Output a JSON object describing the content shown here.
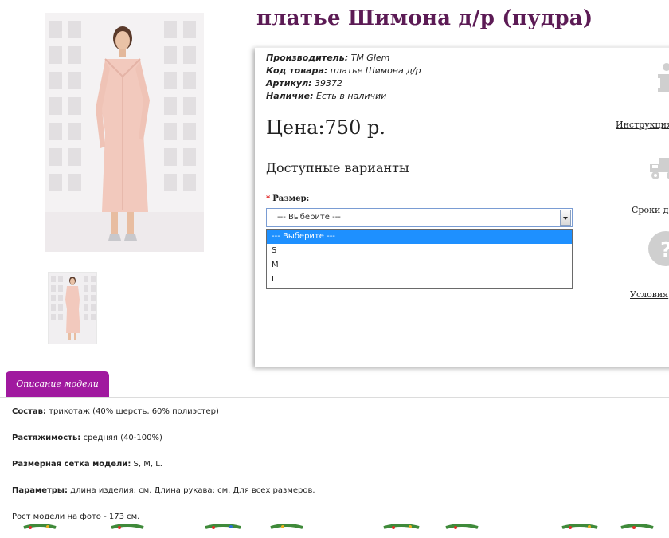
{
  "product": {
    "title": "платье Шимона д/р (пудра)"
  },
  "info": {
    "manufacturer_label": "Производитель:",
    "manufacturer_value": "TM Glem",
    "code_label": "Код товара:",
    "code_value": "платье Шимона д/р",
    "article_label": "Артикул:",
    "article_value": "39372",
    "stock_label": "Наличие:",
    "stock_value": "Есть в наличии"
  },
  "price": "Цена:750 р.",
  "variants_heading": "Доступные варианты",
  "size": {
    "required_mark": "*",
    "label": "Размер:",
    "selected": "--- Выберите ---",
    "options": [
      "--- Выберите ---",
      "S",
      "M",
      "L"
    ]
  },
  "side_links": {
    "instructions": "Инструкция",
    "delivery": "Сроки до",
    "conditions": "Условия"
  },
  "tab": {
    "label": "Описание модели"
  },
  "description": {
    "composition_label": "Состав:",
    "composition_value": " трикотаж (40% шерсть, 60% полиэстер)",
    "stretch_label": "Растяжимость:",
    "stretch_value": " средняя (40-100%)",
    "sizes_label": "Размерная сетка модели:",
    "sizes_value": " S, M, L.",
    "params_label": "Параметры:",
    "params_value": " длина изделия: см. Длина рукава: см. Для всех размеров.",
    "height_text": "Рост модели на фото - 173 см."
  },
  "colors": {
    "title": "#5c1b55",
    "tab": "#a0199f",
    "dress": "#f2c9bd",
    "selected_option": "#1e90ff",
    "icon_gray": "#cfcfcf"
  }
}
